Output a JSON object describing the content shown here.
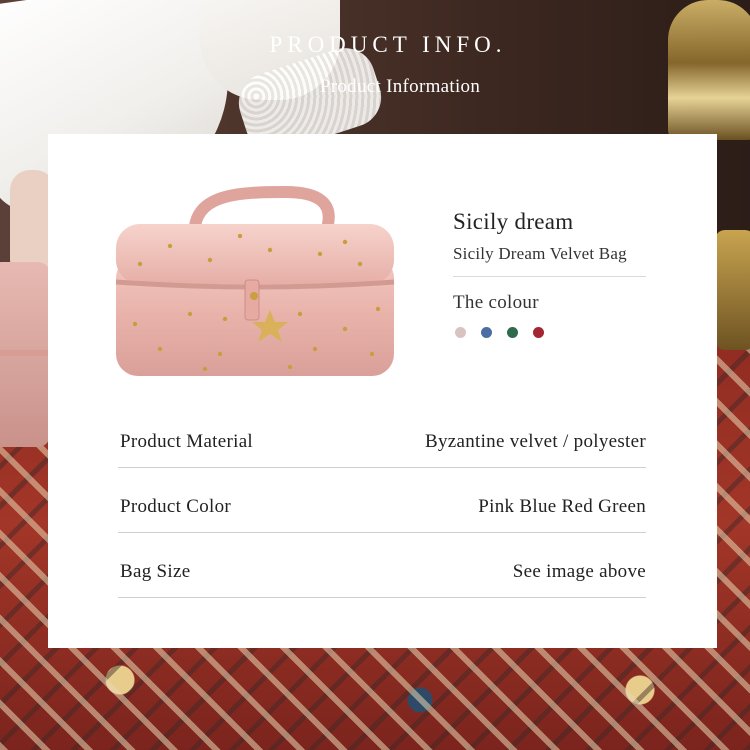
{
  "header": {
    "title": "PRODUCT INFO.",
    "subtitle": "Product Information"
  },
  "product": {
    "name": "Sicily dream",
    "subname": "Sicily Dream Velvet Bag",
    "colour_label": "The colour",
    "colours": [
      {
        "name": "pink",
        "hex": "#d9c3c0"
      },
      {
        "name": "blue",
        "hex": "#4a6ea3"
      },
      {
        "name": "green",
        "hex": "#2f6a4c"
      },
      {
        "name": "red",
        "hex": "#a32633"
      }
    ],
    "image_icon": "velvet-vanity-bag"
  },
  "specs": [
    {
      "label": "Product Material",
      "value": "Byzantine velvet / polyester"
    },
    {
      "label": "Product Color",
      "value": "Pink Blue Red Green"
    },
    {
      "label": "Bag Size",
      "value": "See image above"
    }
  ]
}
